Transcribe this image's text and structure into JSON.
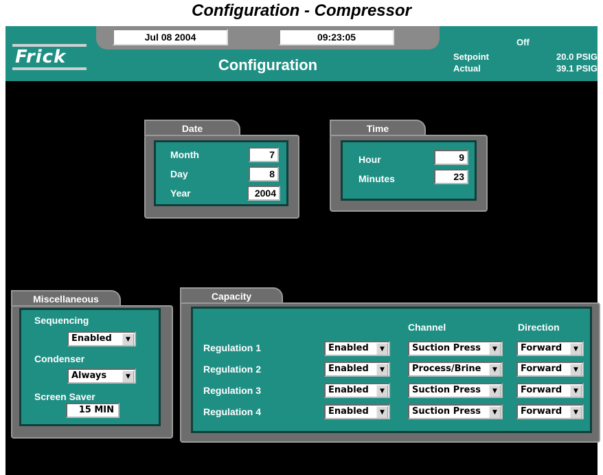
{
  "doc_title": "Configuration - Compressor",
  "header": {
    "date": "Jul 08 2004",
    "time": "09:23:05",
    "logo": "Frick",
    "title": "Configuration",
    "status": "Off",
    "setpoint_label": "Setpoint",
    "setpoint_value": "20.0 PSIG",
    "actual_label": "Actual",
    "actual_value": "39.1 PSIG"
  },
  "date_panel": {
    "title": "Date",
    "month_label": "Month",
    "month_value": "7",
    "day_label": "Day",
    "day_value": "8",
    "year_label": "Year",
    "year_value": "2004"
  },
  "time_panel": {
    "title": "Time",
    "hour_label": "Hour",
    "hour_value": "9",
    "minutes_label": "Minutes",
    "minutes_value": "23"
  },
  "misc_panel": {
    "title": "Miscellaneous",
    "sequencing_label": "Sequencing",
    "sequencing_value": "Enabled",
    "condenser_label": "Condenser",
    "condenser_value": "Always",
    "screen_saver_label": "Screen Saver",
    "screen_saver_value": "15 MIN"
  },
  "capacity_panel": {
    "title": "Capacity",
    "channel_header": "Channel",
    "direction_header": "Direction",
    "rows": [
      {
        "label": "Regulation 1",
        "enabled": "Enabled",
        "channel": "Suction Press",
        "direction": "Forward"
      },
      {
        "label": "Regulation 2",
        "enabled": "Enabled",
        "channel": "Process/Brine",
        "direction": "Forward"
      },
      {
        "label": "Regulation 3",
        "enabled": "Enabled",
        "channel": "Suction Press",
        "direction": "Forward"
      },
      {
        "label": "Regulation 4",
        "enabled": "Enabled",
        "channel": "Suction Press",
        "direction": "Forward"
      }
    ]
  },
  "colors": {
    "teal": "#1f8f84",
    "panel_gray": "#6d6d6d",
    "screen_bg": "#000000"
  },
  "icons": {
    "dropdown": "chevron-down-icon"
  }
}
